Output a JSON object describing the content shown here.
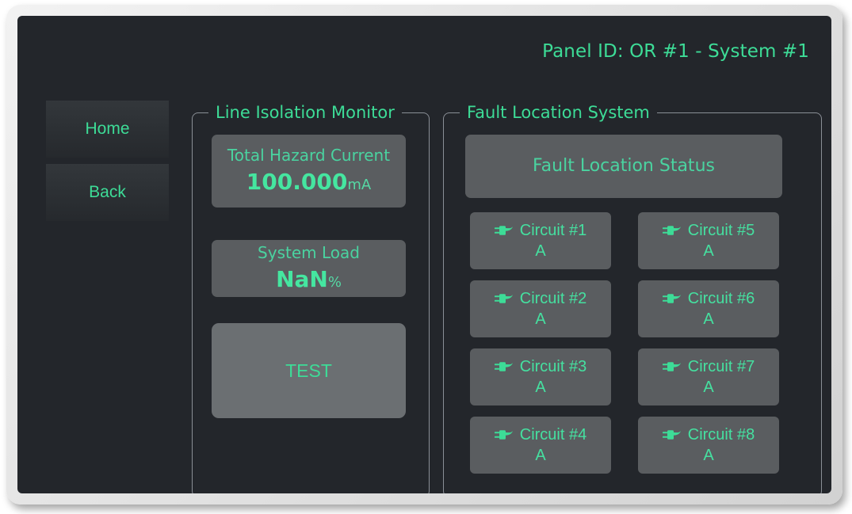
{
  "header": {
    "panel_id": "Panel ID: OR #1 - System #1"
  },
  "nav": {
    "home_label": "Home",
    "back_label": "Back"
  },
  "line_isolation_monitor": {
    "legend": "Line Isolation Monitor",
    "hazard_current": {
      "label": "Total Hazard Current",
      "value": "100.000",
      "unit": "mA"
    },
    "system_load": {
      "label": "System Load",
      "value": "NaN",
      "unit": "%"
    },
    "test_button_label": "TEST"
  },
  "fault_location_system": {
    "legend": "Fault Location System",
    "status_label": "Fault Location Status",
    "circuits": [
      {
        "name": "Circuit #1",
        "value": "A",
        "icon": "plug-icon"
      },
      {
        "name": "Circuit #5",
        "value": "A",
        "icon": "plug-icon"
      },
      {
        "name": "Circuit #2",
        "value": "A",
        "icon": "plug-icon"
      },
      {
        "name": "Circuit #6",
        "value": "A",
        "icon": "plug-icon"
      },
      {
        "name": "Circuit #3",
        "value": "A",
        "icon": "plug-icon"
      },
      {
        "name": "Circuit #7",
        "value": "A",
        "icon": "plug-icon"
      },
      {
        "name": "Circuit #4",
        "value": "A",
        "icon": "plug-icon"
      },
      {
        "name": "Circuit #8",
        "value": "A",
        "icon": "plug-icon"
      }
    ]
  },
  "colors": {
    "accent_green": "#3ddc97",
    "value_green": "#45e6a0",
    "screen_bg": "#23262b",
    "tile_bg": "#5a5d60",
    "test_button_bg": "#6b6f72",
    "group_border": "#8a8f96",
    "bezel": "#e3e3e3"
  }
}
